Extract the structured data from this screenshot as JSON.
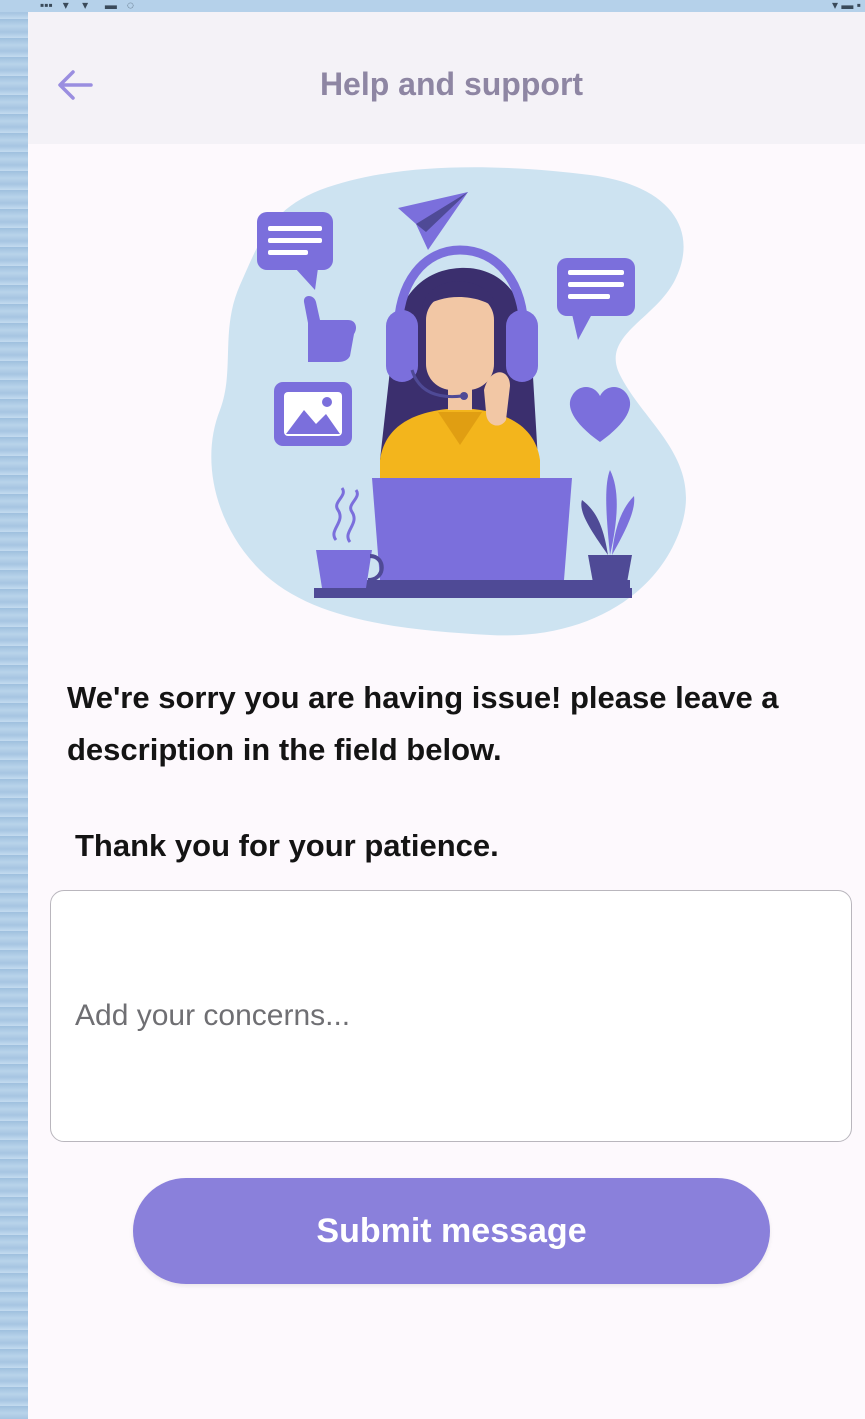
{
  "header": {
    "title": "Help and support",
    "back_icon": "arrow-left-icon"
  },
  "illustration": {
    "description_icon": "customer-support-illustration",
    "colors": {
      "blob": "#cde3f1",
      "primary": "#7b6fdc",
      "dark": "#4f4a96",
      "shirt": "#f3b51c",
      "hair": "#3b2f6e",
      "skin": "#f2c7a5"
    }
  },
  "content": {
    "message": "We're sorry you are having issue! please leave a description in the field below.",
    "thanks": "Thank you for your patience."
  },
  "form": {
    "concerns_placeholder": "Add your concerns...",
    "concerns_value": "",
    "submit_label": "Submit message"
  },
  "colors": {
    "accent": "#8a80db",
    "title": "#8e86a3",
    "back_arrow": "#9a8ee0"
  }
}
